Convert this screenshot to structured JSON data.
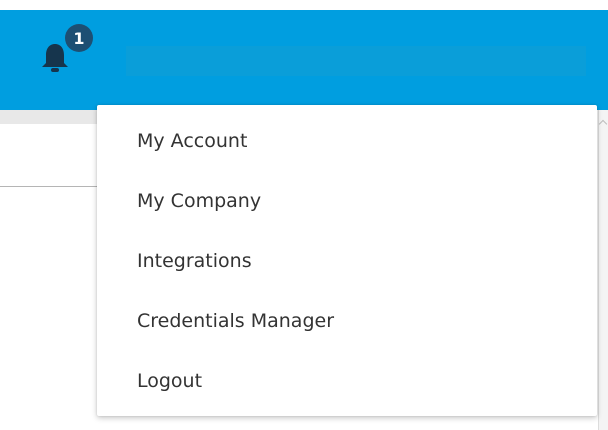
{
  "header": {
    "bell_icon": "bell-icon",
    "notification_count": "1",
    "brand_color": "#009ee0",
    "badge_color": "#1d4f73"
  },
  "user_menu": {
    "items": [
      {
        "label": "My Account"
      },
      {
        "label": "My Company"
      },
      {
        "label": "Integrations"
      },
      {
        "label": "Credentials Manager"
      },
      {
        "label": "Logout"
      }
    ]
  }
}
